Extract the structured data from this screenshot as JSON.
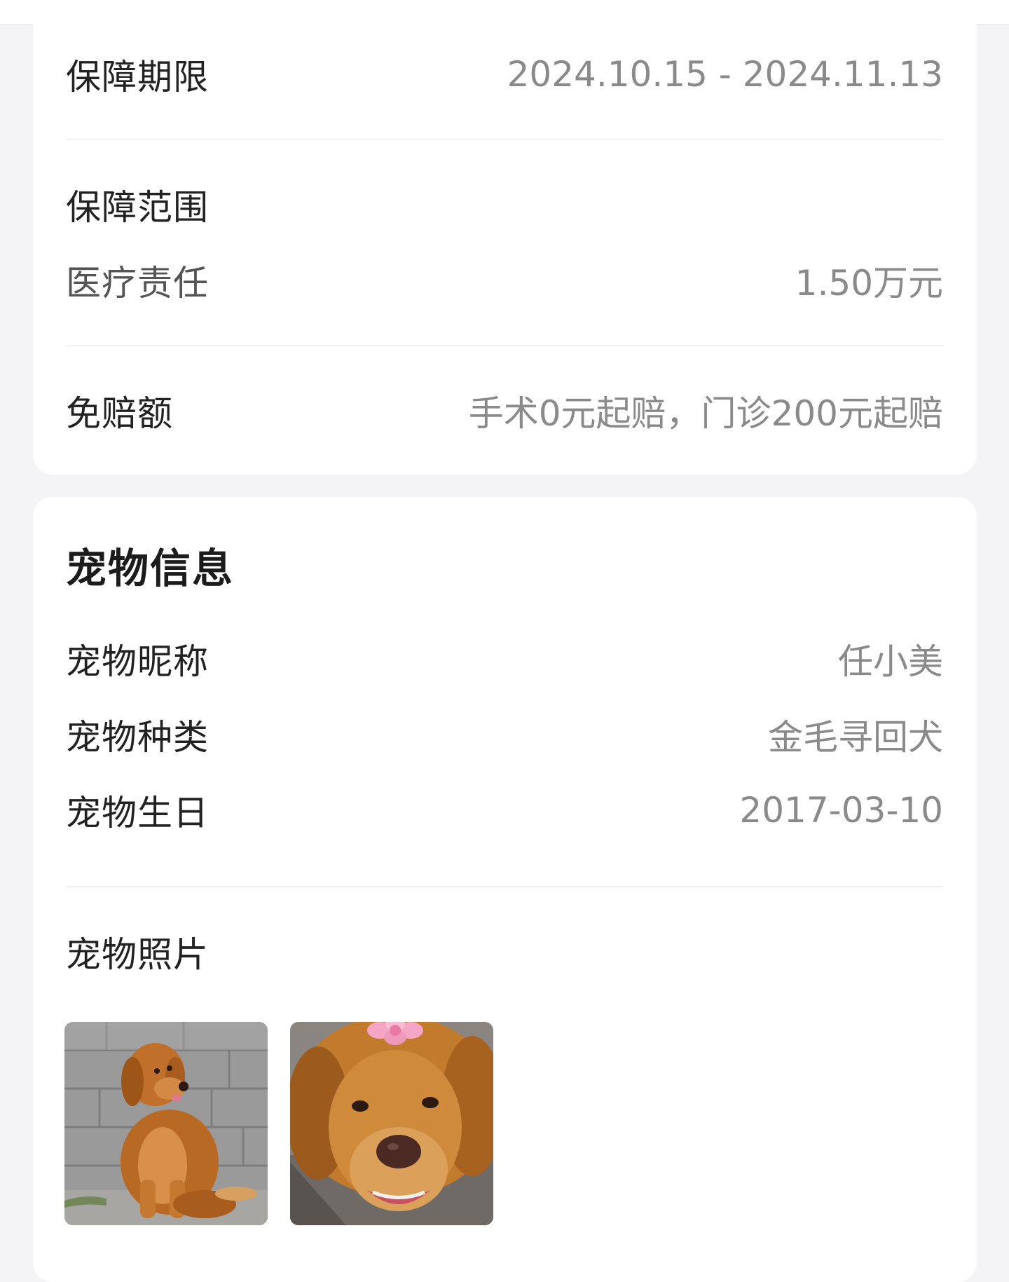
{
  "coverage": {
    "period_label": "保障期限",
    "period_value": "2024.10.15 - 2024.11.13",
    "scope_label": "保障范围",
    "medical_label": "医疗责任",
    "medical_value": "1.50万元",
    "deductible_label": "免赔额",
    "deductible_value": "手术0元起赔，门诊200元起赔"
  },
  "pet_info": {
    "title": "宠物信息",
    "nickname_label": "宠物昵称",
    "nickname_value": "任小美",
    "breed_label": "宠物种类",
    "breed_value": "金毛寻回犬",
    "birthday_label": "宠物生日",
    "birthday_value": "2017-03-10",
    "photos_label": "宠物照片",
    "photos": [
      {
        "name": "pet-photo-sitting-dog"
      },
      {
        "name": "pet-photo-dog-face"
      }
    ]
  },
  "colors": {
    "background": "#f4f4f6",
    "card": "#ffffff",
    "label_text": "#222222",
    "value_text": "#8a8a8a",
    "divider": "#f1f1f3"
  }
}
